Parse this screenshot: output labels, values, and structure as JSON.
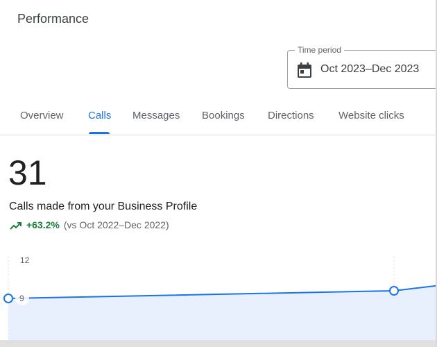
{
  "header": {
    "title": "Performance"
  },
  "time_period": {
    "label": "Time period",
    "value": "Oct 2023–Dec 2023",
    "icon": "calendar-icon"
  },
  "tabs": [
    {
      "label": "Overview",
      "active": false
    },
    {
      "label": "Calls",
      "active": true
    },
    {
      "label": "Messages",
      "active": false
    },
    {
      "label": "Bookings",
      "active": false
    },
    {
      "label": "Directions",
      "active": false
    },
    {
      "label": "Website clicks",
      "active": false
    }
  ],
  "metric": {
    "value": "31",
    "description": "Calls made from your Business Profile",
    "change": "+63.2%",
    "comparison": "(vs Oct 2022–Dec 2022)",
    "trend_icon": "trending-up-icon",
    "trend_color": "#188038"
  },
  "chart_data": {
    "type": "area",
    "y_ticks": [
      "12",
      "9"
    ],
    "ylim": [
      6,
      12
    ],
    "values": [
      9,
      9.6,
      10
    ],
    "highlight_points": [
      0,
      1
    ],
    "line_color": "#1a73e8",
    "fill_color": "#e8f0fe"
  },
  "colors": {
    "accent": "#1a73e8",
    "positive": "#188038"
  }
}
